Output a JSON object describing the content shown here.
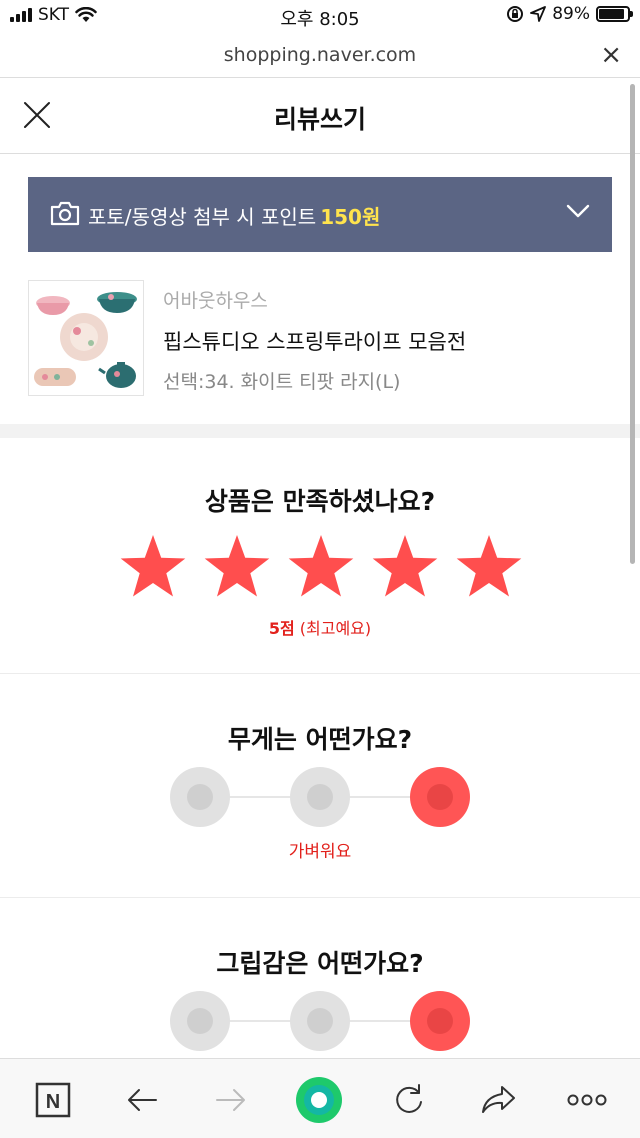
{
  "status_bar": {
    "carrier": "SKT",
    "time": "오후 8:05",
    "battery": "89%",
    "battery_level": 0.89
  },
  "browser": {
    "url": "shopping.naver.com"
  },
  "header": {
    "title": "리뷰쓰기"
  },
  "photo_banner": {
    "text": "포토/동영상 첨부 시 포인트",
    "points": "150원"
  },
  "product": {
    "brand": "어바웃하우스",
    "name": "핍스튜디오 스프링투라이프 모음전",
    "option": "선택:34. 화이트 티팟 라지(L)"
  },
  "rating": {
    "question": "상품은 만족하셨나요?",
    "stars": 5,
    "max_stars": 5,
    "score": "5점",
    "score_desc": "(최고예요)",
    "star_color": "#ff4e4e"
  },
  "weight": {
    "question": "무게는 어떤가요?",
    "selected": 3,
    "selected_label": "가벼워요"
  },
  "grip": {
    "question": "그립감은 어떤가요?",
    "selected": 3
  },
  "colors": {
    "accent": "#e2211c",
    "banner_bg": "#5b6584",
    "points": "#ffe34d",
    "green": "#1ec96b"
  },
  "toolbar": {
    "icons": [
      "naver-n-icon",
      "back-arrow-icon",
      "forward-arrow-icon",
      "green-dot-icon",
      "refresh-icon",
      "share-icon",
      "more-icon"
    ]
  }
}
